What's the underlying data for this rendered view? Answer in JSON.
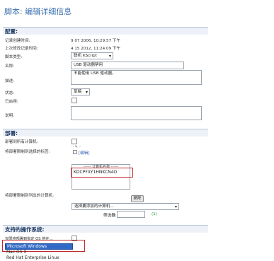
{
  "page_title": "脚本: 编辑详细信息",
  "sections": {
    "config": "配置:",
    "deploy": "部署:",
    "os": "支持的操作系统:"
  },
  "fields": {
    "created_label": "记录创建时间:",
    "created_value": "9 07 2006, 10:29:57 下午",
    "modified_label": "上次修改记录时间:",
    "modified_value": "4 15 2012, 11:24:09 下午",
    "type_label": "脚本类型:",
    "type_value": "联机 KScript",
    "name_label": "名称:",
    "name_value": "USB 驱动器禁用",
    "desc_label": "描述:",
    "desc_value": "不能使用 USB 驱动器。",
    "status_label": "状态:",
    "status_value": "草稿",
    "enabled_label": "已启用:",
    "notes_label": "说明:"
  },
  "deploy": {
    "all_label": "部署到所有计算机:",
    "tags_label": "将部署限制到选择的标签:",
    "tag_icon_text": "·· ✎ ··",
    "edit_link": "[编辑]",
    "machines_header": "------ 计算机名称 ------",
    "machine_selected": "KDCPFXY1HNKCN4O",
    "limit_machines_label": "将部署限制到列出的计算机:",
    "remove_button": "移除",
    "add_machine_placeholder": "选择要添加的计算机...",
    "filter_label": "筛选器:",
    "filter_count": "(1)"
  },
  "os": {
    "label": "仅限将部署到指定 OS 将在...",
    "options": [
      "Microsoft Windows",
      "Mac OS X",
      "Red Hat Enterprise Linux"
    ],
    "selected": "Microsoft Windows"
  },
  "colors": {
    "accent": "#3a6fb0",
    "highlight_red": "#c0282d",
    "selection_blue": "#3169c6"
  }
}
